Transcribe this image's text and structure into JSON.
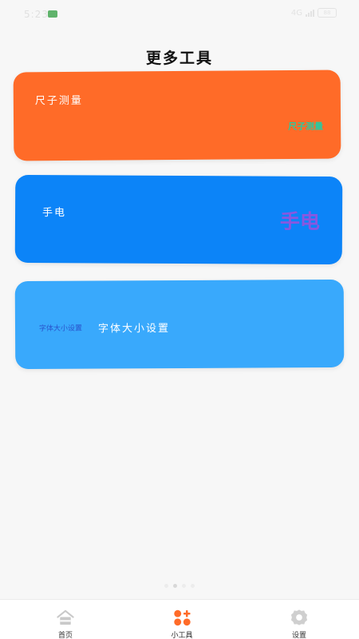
{
  "status_bar": {
    "time": "5:23",
    "network": "4G",
    "battery": "88"
  },
  "page": {
    "title": "更多工具"
  },
  "cards": {
    "ruler": {
      "title": "尺子测量",
      "subtitle": "尺子测量",
      "color": "#ff6b28"
    },
    "torch": {
      "title": "手电",
      "big_label": "手电",
      "color": "#0c84f8"
    },
    "font_size": {
      "small_label": "字体大小设置",
      "title": "字体大小设置",
      "color": "#39a9fc"
    }
  },
  "pager": {
    "total": 4,
    "active_index": 1
  },
  "bottom_nav": {
    "items": [
      {
        "label": "首页",
        "icon": "home-icon",
        "active": false
      },
      {
        "label": "小工具",
        "icon": "tools-icon",
        "active": true
      },
      {
        "label": "设置",
        "icon": "gear-icon",
        "active": false
      }
    ],
    "accent_color": "#ff6b28"
  }
}
